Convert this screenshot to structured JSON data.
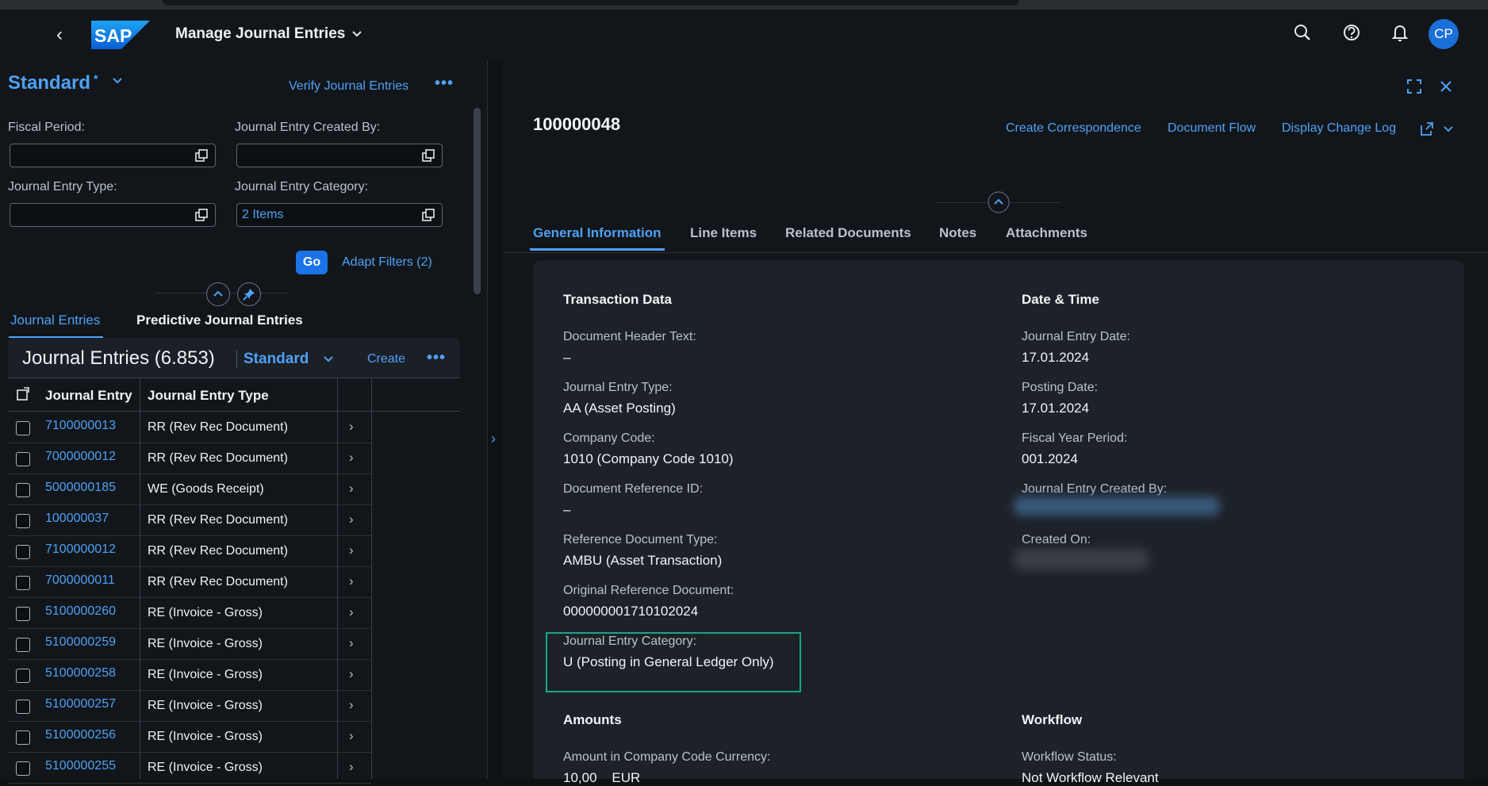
{
  "shell": {
    "logo_text": "SAP",
    "app_title": "Manage Journal Entries",
    "avatar": "CP",
    "icons": [
      "back-icon",
      "search-icon",
      "help-icon",
      "bell-icon"
    ]
  },
  "filter_bar": {
    "variant": "Standard",
    "variant_modified_mark": "*",
    "verify_link": "Verify Journal Entries",
    "fields": [
      {
        "label": "Fiscal Period:",
        "value": ""
      },
      {
        "label": "Journal Entry Created By:",
        "value": ""
      },
      {
        "label": "Journal Entry Type:",
        "value": ""
      },
      {
        "label": "Journal Entry Category:",
        "value": "2 Items"
      }
    ],
    "go_label": "Go",
    "adapt_filters_label": "Adapt Filters (2)"
  },
  "left_tabs": [
    {
      "label": "Journal Entries",
      "active": true
    },
    {
      "label": "Predictive Journal Entries",
      "active": false
    }
  ],
  "table": {
    "title": "Journal Entries (6.853)",
    "variant": "Standard",
    "create_label": "Create",
    "columns": [
      "Journal Entry",
      "Journal Entry Type"
    ],
    "rows": [
      {
        "entry": "7100000013",
        "type": "RR (Rev Rec Document)"
      },
      {
        "entry": "7000000012",
        "type": "RR (Rev Rec Document)"
      },
      {
        "entry": "5000000185",
        "type": "WE (Goods Receipt)"
      },
      {
        "entry": "100000037",
        "type": "RR (Rev Rec Document)"
      },
      {
        "entry": "7100000012",
        "type": "RR (Rev Rec Document)"
      },
      {
        "entry": "7000000011",
        "type": "RR (Rev Rec Document)"
      },
      {
        "entry": "5100000260",
        "type": "RE (Invoice - Gross)"
      },
      {
        "entry": "5100000259",
        "type": "RE (Invoice - Gross)"
      },
      {
        "entry": "5100000258",
        "type": "RE (Invoice - Gross)"
      },
      {
        "entry": "5100000257",
        "type": "RE (Invoice - Gross)"
      },
      {
        "entry": "5100000256",
        "type": "RE (Invoice - Gross)"
      },
      {
        "entry": "5100000255",
        "type": "RE (Invoice - Gross)"
      }
    ]
  },
  "object": {
    "title": "100000048",
    "header_links": [
      "Create Correspondence",
      "Document Flow",
      "Display Change Log"
    ],
    "tabs": [
      {
        "label": "General Information",
        "active": true
      },
      {
        "label": "Line Items",
        "active": false
      },
      {
        "label": "Related Documents",
        "active": false
      },
      {
        "label": "Notes",
        "active": false
      },
      {
        "label": "Attachments",
        "active": false
      }
    ],
    "transaction": {
      "title": "Transaction Data",
      "fields": [
        {
          "label": "Document Header Text:",
          "value": "–"
        },
        {
          "label": "Journal Entry Type:",
          "value": "AA (Asset Posting)"
        },
        {
          "label": "Company Code:",
          "value": "1010 (Company Code 1010)"
        },
        {
          "label": "Document Reference ID:",
          "value": "–"
        },
        {
          "label": "Reference Document Type:",
          "value": "AMBU (Asset Transaction)"
        },
        {
          "label": "Original Reference Document:",
          "value": "000000001710102024"
        },
        {
          "label": "Journal Entry Category:",
          "value": "U (Posting in General Ledger Only)"
        }
      ]
    },
    "datetime": {
      "title": "Date & Time",
      "fields": [
        {
          "label": "Journal Entry Date:",
          "value": "17.01.2024"
        },
        {
          "label": "Posting Date:",
          "value": "17.01.2024"
        },
        {
          "label": "Fiscal Year Period:",
          "value": "001.2024"
        },
        {
          "label": "Journal Entry Created By:",
          "value": ""
        },
        {
          "label": "Created On:",
          "value": ""
        }
      ]
    },
    "amounts": {
      "title": "Amounts",
      "fields": [
        {
          "label": "Amount in Company Code Currency:",
          "value": "10,00    EUR"
        }
      ]
    },
    "workflow": {
      "title": "Workflow",
      "fields": [
        {
          "label": "Workflow Status:",
          "value": "Not Workflow Relevant"
        }
      ]
    }
  },
  "colors": {
    "accent": "#4ea1f5",
    "highlight": "#18a58a",
    "background": "#12161a",
    "card": "#1d2228"
  }
}
